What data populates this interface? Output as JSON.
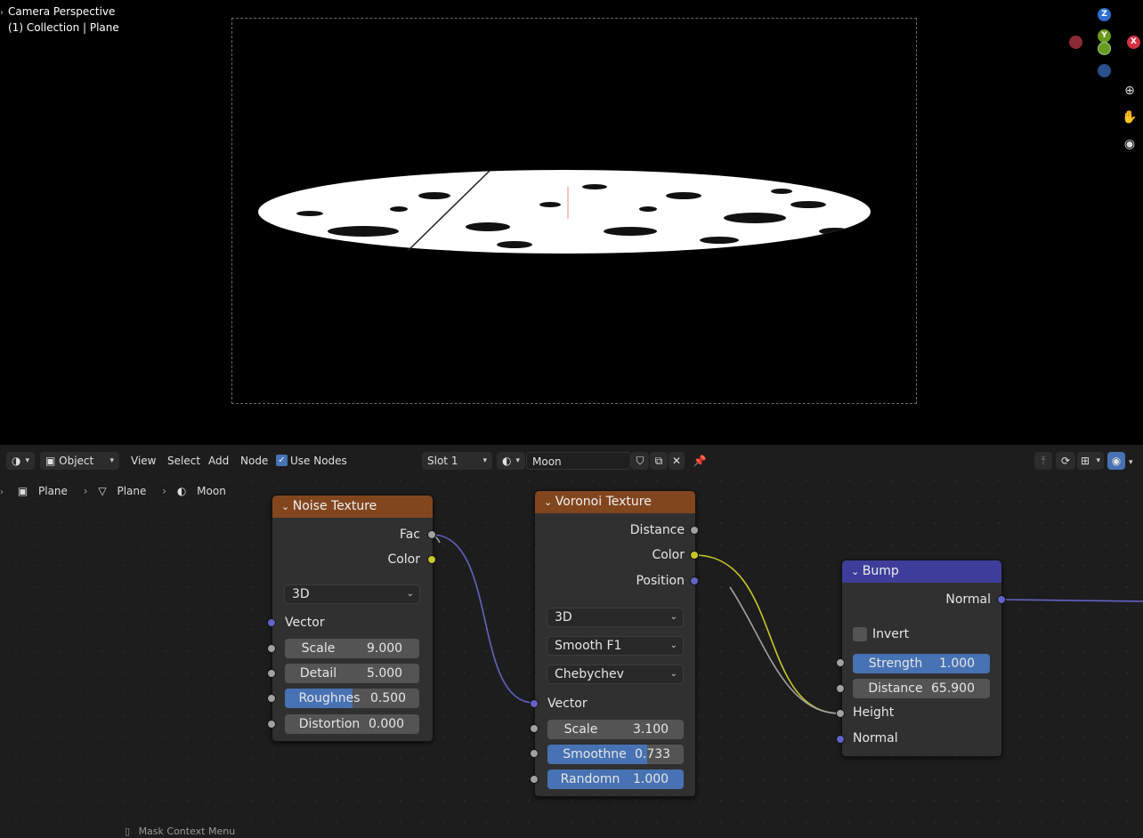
{
  "viewport": {
    "title": "Camera Perspective",
    "subtitle": "(1) Collection | Plane",
    "gizmo": {
      "z": "Z",
      "y": "Y",
      "x": "X"
    }
  },
  "header": {
    "editor_type_icon": "node-editor-icon",
    "mode": "Object",
    "menus": [
      "View",
      "Select",
      "Add",
      "Node"
    ],
    "use_nodes_label": "Use Nodes",
    "use_nodes_checked": true,
    "slot": "Slot 1",
    "material_name": "Moon"
  },
  "breadcrumb": {
    "items": [
      "Plane",
      "Plane",
      "Moon"
    ]
  },
  "nodes": {
    "noise": {
      "title": "Noise Texture",
      "outputs": [
        "Fac",
        "Color"
      ],
      "dimension": "3D",
      "vector_label": "Vector",
      "fields": [
        {
          "label": "Scale",
          "value": "9.000"
        },
        {
          "label": "Detail",
          "value": "5.000"
        },
        {
          "label": "Roughnes",
          "value": "0.500",
          "fill": 0.5
        },
        {
          "label": "Distortion",
          "value": "0.000"
        }
      ]
    },
    "voronoi": {
      "title": "Voronoi Texture",
      "outputs": [
        "Distance",
        "Color",
        "Position"
      ],
      "dimension": "3D",
      "feature": "Smooth F1",
      "metric": "Chebychev",
      "vector_label": "Vector",
      "fields": [
        {
          "label": "Scale",
          "value": "3.100"
        },
        {
          "label": "Smoothne",
          "value": "0.733",
          "fill": 0.733
        },
        {
          "label": "Randomn",
          "value": "1.000",
          "fill": 1.0
        }
      ]
    },
    "bump": {
      "title": "Bump",
      "output": "Normal",
      "invert_label": "Invert",
      "fields": [
        {
          "label": "Strength",
          "value": "1.000",
          "fill": 1.0
        },
        {
          "label": "Distance",
          "value": "65.900"
        }
      ],
      "inputs": [
        "Height",
        "Normal"
      ]
    }
  },
  "status": {
    "hint": "Mask Context Menu"
  }
}
